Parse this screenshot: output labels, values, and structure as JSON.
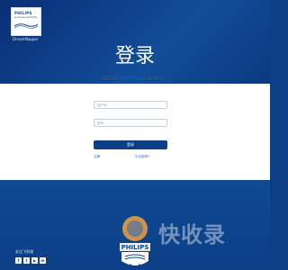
{
  "brand": {
    "logo_wordmark": "PHILIPS",
    "logo_tagline": "sense and simplicity",
    "product_name": "DreamMapper"
  },
  "login": {
    "title": "登录",
    "subtitle_prefix": "使用您的 ",
    "subtitle_brand": "DreamMapper",
    "subtitle_suffix": " 帐户登录。",
    "username_placeholder": "用户名",
    "password_placeholder": "密码",
    "submit_label": "登录",
    "register_link": "注册",
    "forgot_link": "忘记密码?"
  },
  "footer": {
    "follow_label": "关注飞利浦",
    "social_icons": [
      "facebook-icon",
      "twitter-icon",
      "youtube-icon",
      "linkedin-icon"
    ],
    "shield_wordmark": "PHILIPS",
    "watermark": "快收录"
  },
  "colors": {
    "header_blue": "#0b3f86",
    "button_blue": "#0c3f85",
    "link_blue": "#2a65b8"
  }
}
